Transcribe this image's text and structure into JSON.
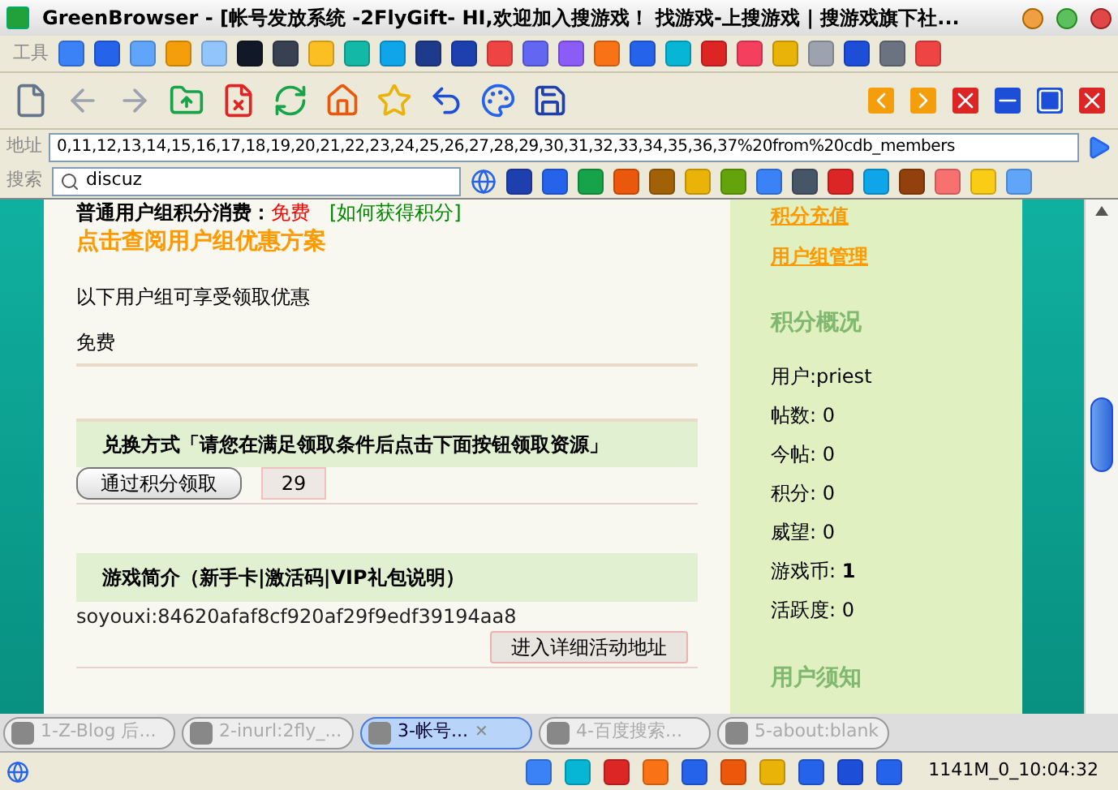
{
  "window": {
    "title": "GreenBrowser - [帐号发放系统 -2FlyGift- HI,欢迎加入搜游戏！ 找游戏-上搜游戏 | 搜游戏旗下社..."
  },
  "toolbar": {
    "label": "工具"
  },
  "address_bar": {
    "label": "地址",
    "value": "0,11,12,13,14,15,16,17,18,19,20,21,22,23,24,25,26,27,28,29,30,31,32,33,34,35,36,37%20from%20cdb_members"
  },
  "search_bar": {
    "label": "搜索",
    "value": "discuz"
  },
  "content": {
    "consume": {
      "label": "普通用户组积分消费：",
      "value": "免费",
      "link": "[如何获得积分]"
    },
    "plan_link": "点击查阅用户组优惠方案",
    "note": "以下用户组可享受领取优惠",
    "group": "免费",
    "exchange_header": "兑换方式「请您在满足领取条件后点击下面按钮领取资源」",
    "claim_button": "通过积分领取",
    "points": "29",
    "intro_header": "游戏简介（新手卡|激活码|VIP礼包说明）",
    "code": "soyouxi:84620afaf8cf920af29f9edf39194aa8",
    "detail_button": "进入详细活动地址"
  },
  "sidebar": {
    "links": [
      "积分充值",
      "用户组管理"
    ],
    "stats_title": "积分概况",
    "stats": [
      "用户:priest",
      "帖数: 0",
      "今帖: 0",
      "积分: 0",
      "威望: 0",
      "游戏币: **1**",
      "活跃度: 0"
    ],
    "notice_title": "用户须知"
  },
  "tabs": [
    {
      "label": "1-Z-Blog 后...",
      "selected": false
    },
    {
      "label": "2-inurl:2fly_...",
      "selected": false
    },
    {
      "label": "3-帐号...",
      "selected": true,
      "close": "✕"
    },
    {
      "label": "4-百度搜索...",
      "selected": false
    },
    {
      "label": "5-about:blank",
      "selected": false
    }
  ],
  "status_bar": {
    "text": "1141M_0_10:04:32"
  }
}
